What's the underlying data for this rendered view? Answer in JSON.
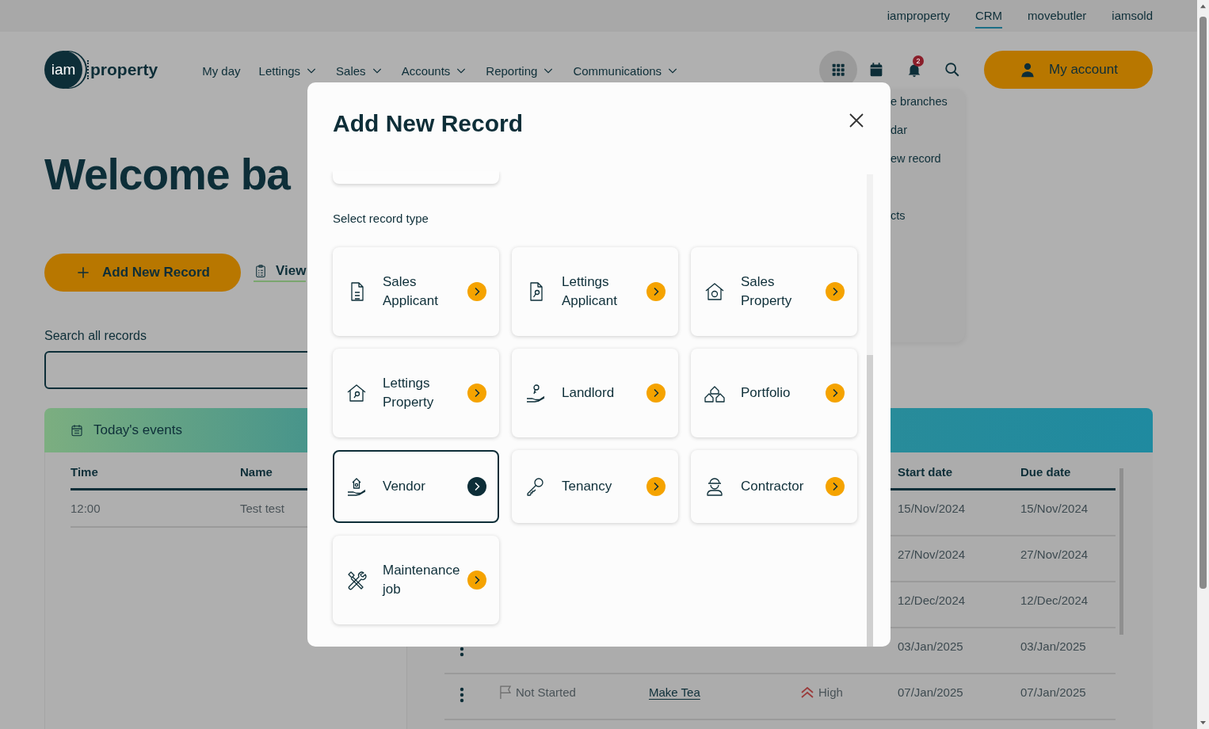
{
  "top_links": [
    {
      "label": "iamproperty",
      "selected": false
    },
    {
      "label": "CRM",
      "selected": true
    },
    {
      "label": "movebutler",
      "selected": false
    },
    {
      "label": "iamsold",
      "selected": false
    }
  ],
  "logo": {
    "badge": "iam",
    "word": "property"
  },
  "nav": [
    {
      "label": "My day",
      "dropdown": false
    },
    {
      "label": "Lettings",
      "dropdown": true
    },
    {
      "label": "Sales",
      "dropdown": true
    },
    {
      "label": "Accounts",
      "dropdown": true
    },
    {
      "label": "Reporting",
      "dropdown": true
    },
    {
      "label": "Communications",
      "dropdown": true
    }
  ],
  "header_tools": {
    "apps_open": true,
    "notifications": "2"
  },
  "account_button": "My account",
  "apps_menu": [
    {
      "label": "e branches",
      "gap_before": false
    },
    {
      "label": "dar",
      "gap_before": false
    },
    {
      "label": "ew record",
      "gap_before": false
    },
    {
      "label": "cts",
      "gap_before": true
    }
  ],
  "welcome": "Welcome ba",
  "add_record_button": "Add New Record",
  "view_link": "View",
  "search": {
    "label": "Search all records"
  },
  "events": {
    "title": "Today's events",
    "columns": [
      "Time",
      "Name"
    ],
    "rows": [
      [
        "12:00",
        "Test test"
      ]
    ]
  },
  "tasks": {
    "columns": [
      "Start date",
      "Due date"
    ],
    "rows": [
      {
        "start": "15/Nov/2024",
        "due": "15/Nov/2024"
      },
      {
        "start": "27/Nov/2024",
        "due": "27/Nov/2024"
      },
      {
        "start": "12/Dec/2024",
        "due": "12/Dec/2024"
      },
      {
        "actions": true,
        "start": "03/Jan/2025",
        "due": "03/Jan/2025"
      },
      {
        "actions": true,
        "status": "Not Started",
        "title": "Make Tea",
        "priority": "High",
        "start": "07/Jan/2025",
        "due": "07/Jan/2025"
      }
    ]
  },
  "modal": {
    "title": "Add New Record",
    "prompt": "Select record type",
    "record_types": [
      {
        "label": "Sales Applicant",
        "kind": "doc_pound",
        "selected": false
      },
      {
        "label": "Lettings Applicant",
        "kind": "doc_key",
        "selected": false
      },
      {
        "label": "Sales Property",
        "kind": "house_pound",
        "selected": false
      },
      {
        "label": "Lettings Property",
        "kind": "house_key",
        "selected": false
      },
      {
        "label": "Landlord",
        "kind": "hand_key",
        "selected": false
      },
      {
        "label": "Portfolio",
        "kind": "houses",
        "selected": false
      },
      {
        "label": "Vendor",
        "kind": "hand_house",
        "selected": true
      },
      {
        "label": "Tenancy",
        "kind": "key",
        "selected": false
      },
      {
        "label": "Contractor",
        "kind": "worker",
        "selected": false
      },
      {
        "label": "Maintenance job",
        "kind": "tools",
        "selected": false
      }
    ]
  }
}
